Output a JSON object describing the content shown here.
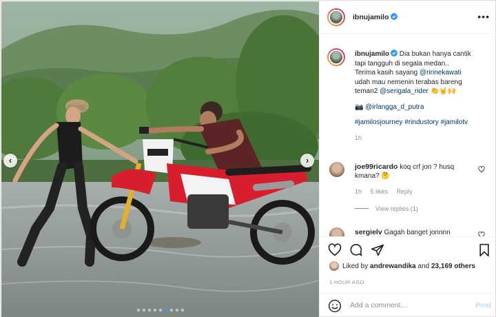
{
  "post": {
    "username": "ibnujamilo",
    "verified": true
  },
  "caption": {
    "username": "ibnujamilo",
    "line1": "Dia bukan hanya cantik",
    "line2": "tapi tangguh di segala medan..",
    "line3": "Terima kasih sayang",
    "mention1": "@ririnekawati",
    "line4": "udah mau nemenin terabas bareng",
    "line5": "teman2",
    "mention2": "@serigala_rider",
    "emojis": "👏🤘🙌",
    "photo_credit_icon": "camera-icon",
    "mention3": "@irlangga_d_putra",
    "hashtag1": "#jamilosjourney",
    "hashtag2": "#rindustory",
    "hashtag3": "#jamilotv",
    "age": "1h"
  },
  "comments": [
    {
      "username": "joe99ricardo",
      "text_line1": "koq crf jon ? husq",
      "text_line2": "kmana?",
      "emoji": "🤔",
      "age": "1h",
      "likes": "5 likes",
      "reply": "Reply",
      "view_replies": "View replies (1)"
    },
    {
      "username": "sergielv",
      "text": "Gagah banget jonnnn"
    }
  ],
  "likes": {
    "prefix": "Liked by",
    "user": "andrewandika",
    "connector": "and",
    "count": "23,169 others"
  },
  "time_ago": "1 HOUR AGO",
  "add_comment": {
    "placeholder": "Add a comment…",
    "post_label": "Post"
  },
  "carousel": {
    "total": 9,
    "active_index": 5
  },
  "colors": {
    "link": "#00376b",
    "verified": "#3897f0",
    "post_disabled": "#b2dffc",
    "meta": "#8e8e8e"
  }
}
